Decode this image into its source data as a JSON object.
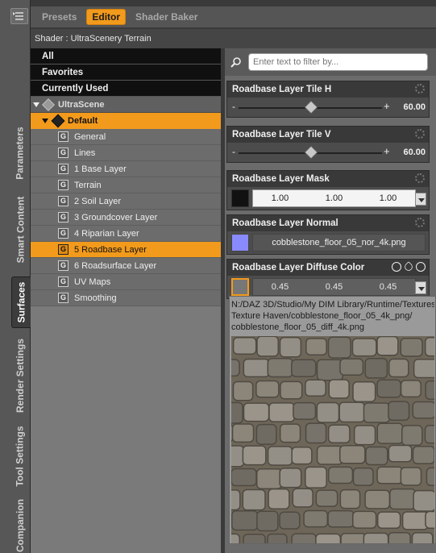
{
  "vertical_tabs": [
    "Parameters",
    "Smart Content",
    "Surfaces",
    "Render Settings",
    "Tool Settings",
    "Companion"
  ],
  "active_vertical_tab": "Surfaces",
  "top_tabs": [
    "Presets",
    "Editor",
    "Shader Baker"
  ],
  "active_top_tab": "Editor",
  "shader_label": "Shader : UltraScenery Terrain",
  "tree": {
    "categories": [
      "All",
      "Favorites",
      "Currently Used"
    ],
    "node": "UltraScene",
    "material": "Default",
    "items": [
      "General",
      "Lines",
      "1 Base Layer",
      "Terrain",
      "2 Soil Layer",
      "3 Groundcover Layer",
      "4 Riparian Layer",
      "5 Roadbase Layer",
      "6 Roadsurface Layer",
      "UV Maps",
      "Smoothing"
    ],
    "selected_item": "5 Roadbase Layer"
  },
  "filter": {
    "placeholder": "Enter text to filter by..."
  },
  "properties": {
    "tile_h": {
      "label": "Roadbase Layer Tile H",
      "value": "60.00",
      "fraction": 0.5
    },
    "tile_v": {
      "label": "Roadbase Layer Tile V",
      "value": "60.00",
      "fraction": 0.5
    },
    "mask": {
      "label": "Roadbase Layer Mask",
      "values": [
        "1.00",
        "1.00",
        "1.00"
      ]
    },
    "normal": {
      "label": "Roadbase Layer Normal",
      "texture": "cobblestone_floor_05_nor_4k.png"
    },
    "diffuse": {
      "label": "Roadbase Layer Diffuse Color",
      "values": [
        "0.45",
        "0.45",
        "0.45"
      ]
    }
  },
  "tooltip": {
    "line1": "N:/DAZ 3D/Studio/My DIM Library/Runtime/Textures/",
    "line2": "Texture Haven/cobblestone_floor_05_4k_png/",
    "line3": "cobblestone_floor_05_diff_4k.png"
  },
  "colors": {
    "accent": "#f29a1c",
    "panel": "#6b6b6b",
    "header": "#393939"
  }
}
